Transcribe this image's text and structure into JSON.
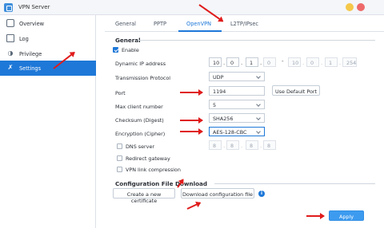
{
  "window": {
    "title": "VPN Server"
  },
  "sidebar": {
    "items": [
      {
        "label": "Overview",
        "icon": "overview-icon",
        "active": false
      },
      {
        "label": "Log",
        "icon": "log-icon",
        "active": false
      },
      {
        "label": "Privilege",
        "icon": "privilege-icon",
        "active": false
      },
      {
        "label": "Settings",
        "icon": "settings-icon",
        "active": true
      }
    ]
  },
  "tabs": [
    {
      "label": "General",
      "active": false
    },
    {
      "label": "PPTP",
      "active": false
    },
    {
      "label": "OpenVPN",
      "active": true
    },
    {
      "label": "L2TP/IPsec",
      "active": false
    }
  ],
  "general": {
    "title": "General",
    "enable_label": "Enable",
    "enable_checked": true,
    "dynamic_ip_label": "Dynamic IP address",
    "dynamic_ip": [
      "10",
      "0",
      "1",
      "0"
    ],
    "dynamic_ip_end": [
      "10",
      "0",
      "1",
      "254"
    ],
    "ip_range_sep": "-",
    "protocol_label": "Transmission Protocol",
    "protocol_value": "UDP",
    "port_label": "Port",
    "port_value": "1194",
    "use_default_port": "Use Default Port",
    "max_client_label": "Max client number",
    "max_client_value": "5",
    "checksum_label": "Checksum (Digest)",
    "checksum_value": "SHA256",
    "encryption_label": "Encryption (Cipher)",
    "encryption_value": "AES-128-CBC",
    "dns_label": "DNS server",
    "dns_checked": false,
    "dns_value": [
      "8",
      "8",
      "8",
      "8"
    ],
    "redirect_label": "Redirect gateway",
    "redirect_checked": false,
    "compression_label": "VPN link compression",
    "compression_checked": false
  },
  "config_download": {
    "title": "Configuration File Download",
    "create_cert": "Create a new certificate",
    "download_config": "Download configuration file",
    "info_icon": "info-icon"
  },
  "footer": {
    "apply": "Apply"
  },
  "colors": {
    "accent": "#1e78d8",
    "annotation": "#e01b1b"
  }
}
